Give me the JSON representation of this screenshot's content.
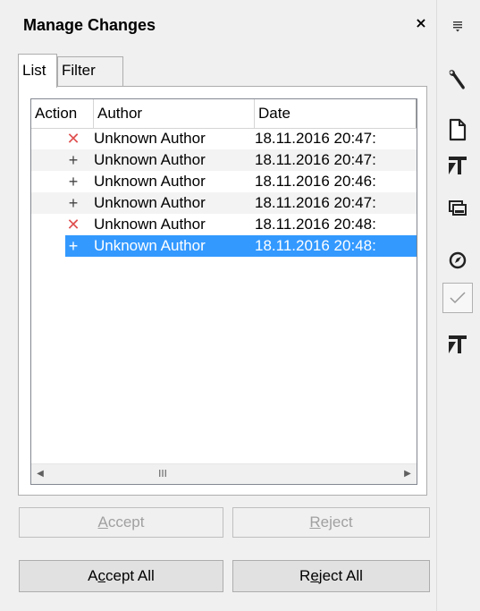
{
  "deck": {
    "title": "Manage Changes",
    "close_label": "×"
  },
  "tabs": [
    {
      "label": "List",
      "active": true
    },
    {
      "label": "Filter",
      "active": false
    }
  ],
  "list": {
    "columns": [
      "Action",
      "Author",
      "Date"
    ],
    "rows": [
      {
        "action": "reject-icon",
        "author": "Unknown Author",
        "date": "18.11.2016 20:47:"
      },
      {
        "action": "insert-icon",
        "author": "Unknown Author",
        "date": "18.11.2016 20:47:"
      },
      {
        "action": "insert-icon",
        "author": "Unknown Author",
        "date": "18.11.2016 20:46:"
      },
      {
        "action": "insert-icon",
        "author": "Unknown Author",
        "date": "18.11.2016 20:47:"
      },
      {
        "action": "reject-icon",
        "author": "Unknown Author",
        "date": "18.11.2016 20:48:"
      },
      {
        "action": "insert-icon",
        "author": "Unknown Author",
        "date": "18.11.2016 20:48:",
        "selected": true
      }
    ],
    "scroll_thumb_glyph": "III"
  },
  "buttons": {
    "accept": {
      "label": "Accept",
      "mnemonic": "A",
      "rest": "ccept",
      "enabled": false
    },
    "reject": {
      "label": "Reject",
      "mnemonic": "R",
      "rest": "eject",
      "enabled": false
    },
    "accept_all": {
      "label": "Accept All",
      "pre": "A",
      "mnemonic": "c",
      "rest": "cept All",
      "enabled": true
    },
    "reject_all": {
      "label": "Reject All",
      "pre": "R",
      "mnemonic": "e",
      "rest": "ject All",
      "enabled": true
    }
  },
  "colors": {
    "selection": "#3399ff",
    "reject_icon": "#e05050",
    "background": "#f0f0f0"
  },
  "tabbar": [
    "menu-icon",
    "properties-wrench-icon",
    "page-icon",
    "styles-icon",
    "gallery-icon",
    "navigator-icon",
    "manage-changes-icon",
    "design-icon"
  ]
}
